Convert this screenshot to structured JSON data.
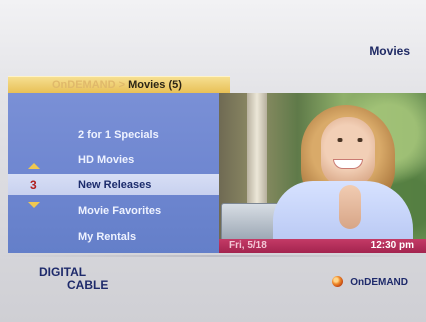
{
  "header": {
    "title": "Movies"
  },
  "breadcrumb": {
    "root": "OnDEMAND",
    "separator": ">",
    "current": "Movies",
    "count": "(5)"
  },
  "menu": {
    "items": [
      {
        "label": "2 for 1 Specials"
      },
      {
        "label": "HD Movies"
      },
      {
        "label": "New Releases",
        "number": "3",
        "selected": true
      },
      {
        "label": "Movie Favorites"
      },
      {
        "label": "My Rentals"
      }
    ]
  },
  "status": {
    "date": "Fri, 5/18",
    "time": "12:30 pm"
  },
  "footer": {
    "brand_line1": "DIGITAL",
    "brand_line2": "CABLE",
    "ondemand_label": "OnDEMAND"
  },
  "icons": {
    "up": "up-arrow-icon",
    "down": "down-arrow-icon",
    "ondemand": "ondemand-logo-icon"
  },
  "colors": {
    "menu": "#6e86d0",
    "crumb": "#e7be53",
    "timebar": "#a3244f",
    "text_dark": "#1e2a6b"
  }
}
